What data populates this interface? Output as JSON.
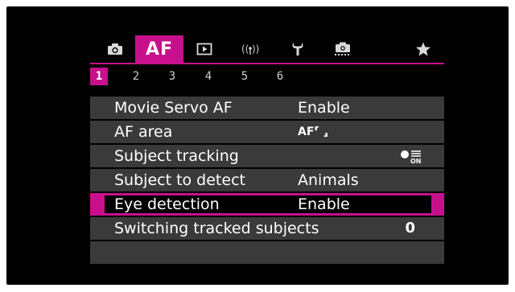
{
  "tabs": {
    "items": [
      {
        "name": "shooting",
        "icon": "camera-icon"
      },
      {
        "name": "af",
        "label": "AF",
        "active": true
      },
      {
        "name": "playback",
        "icon": "playback-icon"
      },
      {
        "name": "wireless",
        "icon": "wireless-icon"
      },
      {
        "name": "setup",
        "icon": "wrench-icon"
      },
      {
        "name": "custom-functions",
        "icon": "custom-camera-icon"
      },
      {
        "name": "my-menu",
        "icon": "star-icon"
      }
    ],
    "accent_color": "#c8108c"
  },
  "pages": [
    "1",
    "2",
    "3",
    "4",
    "5",
    "6"
  ],
  "active_page": "1",
  "menu": {
    "rows": [
      {
        "label": "Movie Servo AF",
        "value": "Enable"
      },
      {
        "label": "AF area",
        "value": "AF⸢ ⸥"
      },
      {
        "label": "Subject tracking",
        "value_icon": "subject-tracking-on-icon",
        "value_icon_text": "ON"
      },
      {
        "label": "Subject to detect",
        "value": "Animals"
      },
      {
        "label": "Eye detection",
        "value": "Enable",
        "selected": true
      },
      {
        "label": "Switching tracked subjects",
        "value": "0"
      }
    ]
  }
}
